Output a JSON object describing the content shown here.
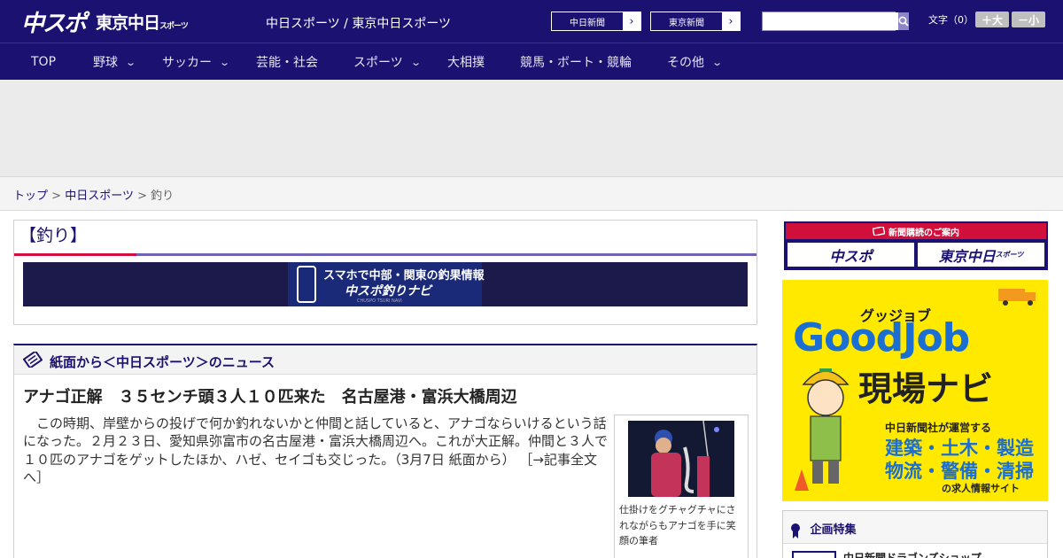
{
  "header": {
    "logo_main": "中スポ",
    "logo_sub": "東京中日",
    "logo_sub_small": "スポーツ",
    "site_title": "中日スポーツ / 東京中日スポーツ",
    "paper_links": [
      {
        "label": "中日新聞"
      },
      {
        "label": "東京新聞"
      }
    ],
    "search_placeholder": "",
    "font_size_label": "文字（0）",
    "font_larger": "＋大",
    "font_smaller": "－小"
  },
  "nav": {
    "items": [
      {
        "label": "TOP",
        "dropdown": false
      },
      {
        "label": "野球",
        "dropdown": true
      },
      {
        "label": "サッカー",
        "dropdown": true
      },
      {
        "label": "芸能・社会",
        "dropdown": false
      },
      {
        "label": "スポーツ",
        "dropdown": true
      },
      {
        "label": "大相撲",
        "dropdown": false
      },
      {
        "label": "競馬・ボート・競輪",
        "dropdown": false
      },
      {
        "label": "その他",
        "dropdown": true
      }
    ],
    "chevron": "⌄"
  },
  "breadcrumb": {
    "items": [
      "トップ",
      "中日スポーツ",
      "釣り"
    ],
    "separator": ">"
  },
  "category": {
    "title": "【釣り】",
    "banner_line1": "スマホで中部・関東の釣果情報",
    "banner_line2": "中スポ釣りナビ",
    "banner_line3": "CHUSPO TSURI NAVI"
  },
  "news": {
    "section_title": "紙面から＜中日スポーツ＞のニュース",
    "headline": "アナゴ正解　３５センチ頭３人１０匹来た　名古屋港・富浜大橋周辺",
    "body": "この時期、岸壁からの投げで何か釣れないかと仲間と話していると、アナゴならいけるという話になった。２月２３日、愛知県弥富市の名古屋港・富浜大橋周辺へ。これが大正解。仲間と３人で１０匹のアナゴをゲットしたほか、ハゼ、セイゴも交じった。（3月7日 紙面から）",
    "read_more": "［→記事全文へ］",
    "photo_caption": "仕掛けをグチャグチャにされながらもアナゴを手に笑顔の筆者"
  },
  "sidebar": {
    "subscribe_title": "新聞購読のご案内",
    "subscribe_chuspo": "中スポ",
    "subscribe_tokyo": "東京中日",
    "subscribe_tokyo_small": "スポーツ",
    "ad": {
      "kana": "グッジョブ",
      "brand": "GoodJob",
      "title": "現場ナビ",
      "line1": "中日新聞社が運営する",
      "line2": "建築・土木・製造",
      "line3": "物流・警備・清掃",
      "line4": "の求人情報サイト"
    },
    "feature_title": "企画特集",
    "feature_item": "中日新聞ドラゴンズショップ"
  },
  "colors": {
    "brand_navy": "#1b1170",
    "accent_red": "#d0103a",
    "ad_yellow": "#ffe900",
    "ad_blue": "#1b6fd3"
  }
}
